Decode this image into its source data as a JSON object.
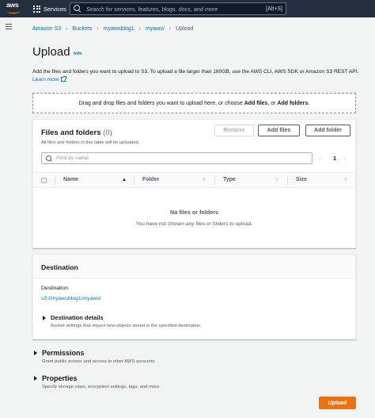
{
  "nav": {
    "logo_text": "aws",
    "services_label": "Services",
    "search_placeholder": "Search for services, features, blogs, docs, and more",
    "search_shortcut": "[Alt+S]"
  },
  "breadcrumb": [
    "Amazon S3",
    "Buckets",
    "myawsblog1",
    "myaws/",
    "Upload"
  ],
  "page": {
    "title": "Upload",
    "info": "Info",
    "description": "Add the files and folders you want to upload to S3. To upload a file larger than 160GB, use the AWS CLI, AWS SDK or Amazon S3 REST API.",
    "learn_more": "Learn more"
  },
  "dropzone": {
    "prefix": "Drag and drop files and folders you want to upload here, or choose ",
    "add_files": "Add files",
    "middle": ", or ",
    "add_folders": "Add folders",
    "suffix": "."
  },
  "files": {
    "title": "Files and folders",
    "count": "(0)",
    "subtitle": "All files and folders in this table will be uploaded.",
    "remove_label": "Remove",
    "add_files_label": "Add files",
    "add_folder_label": "Add folder",
    "find_placeholder": "Find by name",
    "page_number": "1",
    "prev_icon": "‹",
    "next_icon": "›",
    "columns": [
      "Name",
      "Folder",
      "Type",
      "Size"
    ],
    "empty_title": "No files or folders",
    "empty_subtitle": "You have not chosen any files or folders to upload."
  },
  "destination": {
    "title": "Destination",
    "label": "Destination",
    "value": "s3://myawsblog1/myaws/",
    "details_title": "Destination details",
    "details_subtitle": "Bucket settings that impact new objects stored in the specified destination."
  },
  "permissions": {
    "title": "Permissions",
    "subtitle": "Grant public access and access to other AWS accounts."
  },
  "properties": {
    "title": "Properties",
    "subtitle": "Specify storage class, encryption settings, tags, and more."
  },
  "upload_label": "Upload",
  "colors": {
    "nav_bg": "#232f3e",
    "link": "#0073bb",
    "primary_button": "#ec7211",
    "page_bg": "#f2f3f3"
  }
}
